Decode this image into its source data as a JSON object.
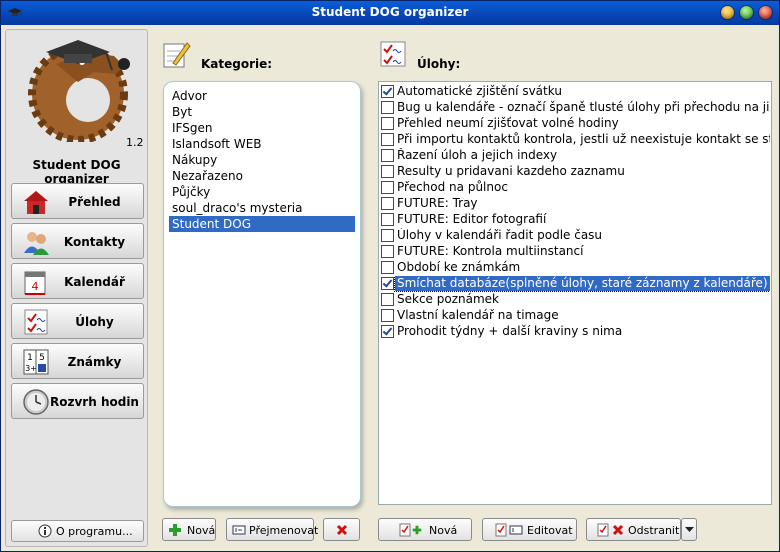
{
  "window": {
    "title": "Student DOG organizer"
  },
  "sidebar": {
    "version": "1.2",
    "app_name": "Student DOG organizer",
    "nav": [
      {
        "label": "Přehled",
        "icon": "house-icon"
      },
      {
        "label": "Kontakty",
        "icon": "contacts-icon"
      },
      {
        "label": "Kalendář",
        "icon": "calendar-icon"
      },
      {
        "label": "Úlohy",
        "icon": "tasks-icon"
      },
      {
        "label": "Známky",
        "icon": "grades-icon"
      },
      {
        "label": "Rozvrh hodin",
        "icon": "clock-icon"
      }
    ],
    "about_label": "O programu..."
  },
  "categories": {
    "header": "Kategorie:",
    "items": [
      "Advor",
      "Byt",
      "IFSgen",
      "Islandsoft WEB",
      "Nákupy",
      "Nezařazeno",
      "Půjčky",
      "soul_draco's mysteria",
      "Student DOG"
    ],
    "selected_index": 8,
    "buttons": {
      "new": "Nová",
      "rename": "Přejmenovat"
    }
  },
  "tasks": {
    "header": "Úlohy:",
    "items": [
      {
        "text": "Automatické zjištění svátku",
        "checked": true
      },
      {
        "text": "Bug u kalendáře - označí španě tlusté úlohy při přechodu na jiný",
        "checked": false
      },
      {
        "text": "Přehled neumí zjišťovat volné hodiny",
        "checked": false
      },
      {
        "text": "Při importu kontaktů kontrola, jestli už neexistuje kontakt se stej",
        "checked": false
      },
      {
        "text": "Řazení úloh a jejich indexy",
        "checked": false
      },
      {
        "text": "Resulty u pridavani kazdeho zaznamu",
        "checked": false
      },
      {
        "text": "Přechod na půlnoc",
        "checked": false
      },
      {
        "text": "FUTURE: Tray",
        "checked": false
      },
      {
        "text": "FUTURE: Editor fotografií",
        "checked": false
      },
      {
        "text": "Úlohy v kalendáři řadit podle času",
        "checked": false
      },
      {
        "text": "FUTURE: Kontrola multiinstancí",
        "checked": false
      },
      {
        "text": "Období ke známkám",
        "checked": false
      },
      {
        "text": "Smíchat databáze(splněné úlohy, staré záznamy z kalendáře)",
        "checked": true
      },
      {
        "text": "Sekce poznámek",
        "checked": false
      },
      {
        "text": "Vlastní kalendář na timage",
        "checked": false
      },
      {
        "text": "Prohodit týdny + další kraviny s nima",
        "checked": true
      }
    ],
    "selected_index": 12,
    "buttons": {
      "new": "Nová",
      "edit": "Editovat",
      "delete": "Odstranit"
    }
  },
  "colors": {
    "selection": "#316ac5",
    "titlebar": "#0846b8"
  }
}
